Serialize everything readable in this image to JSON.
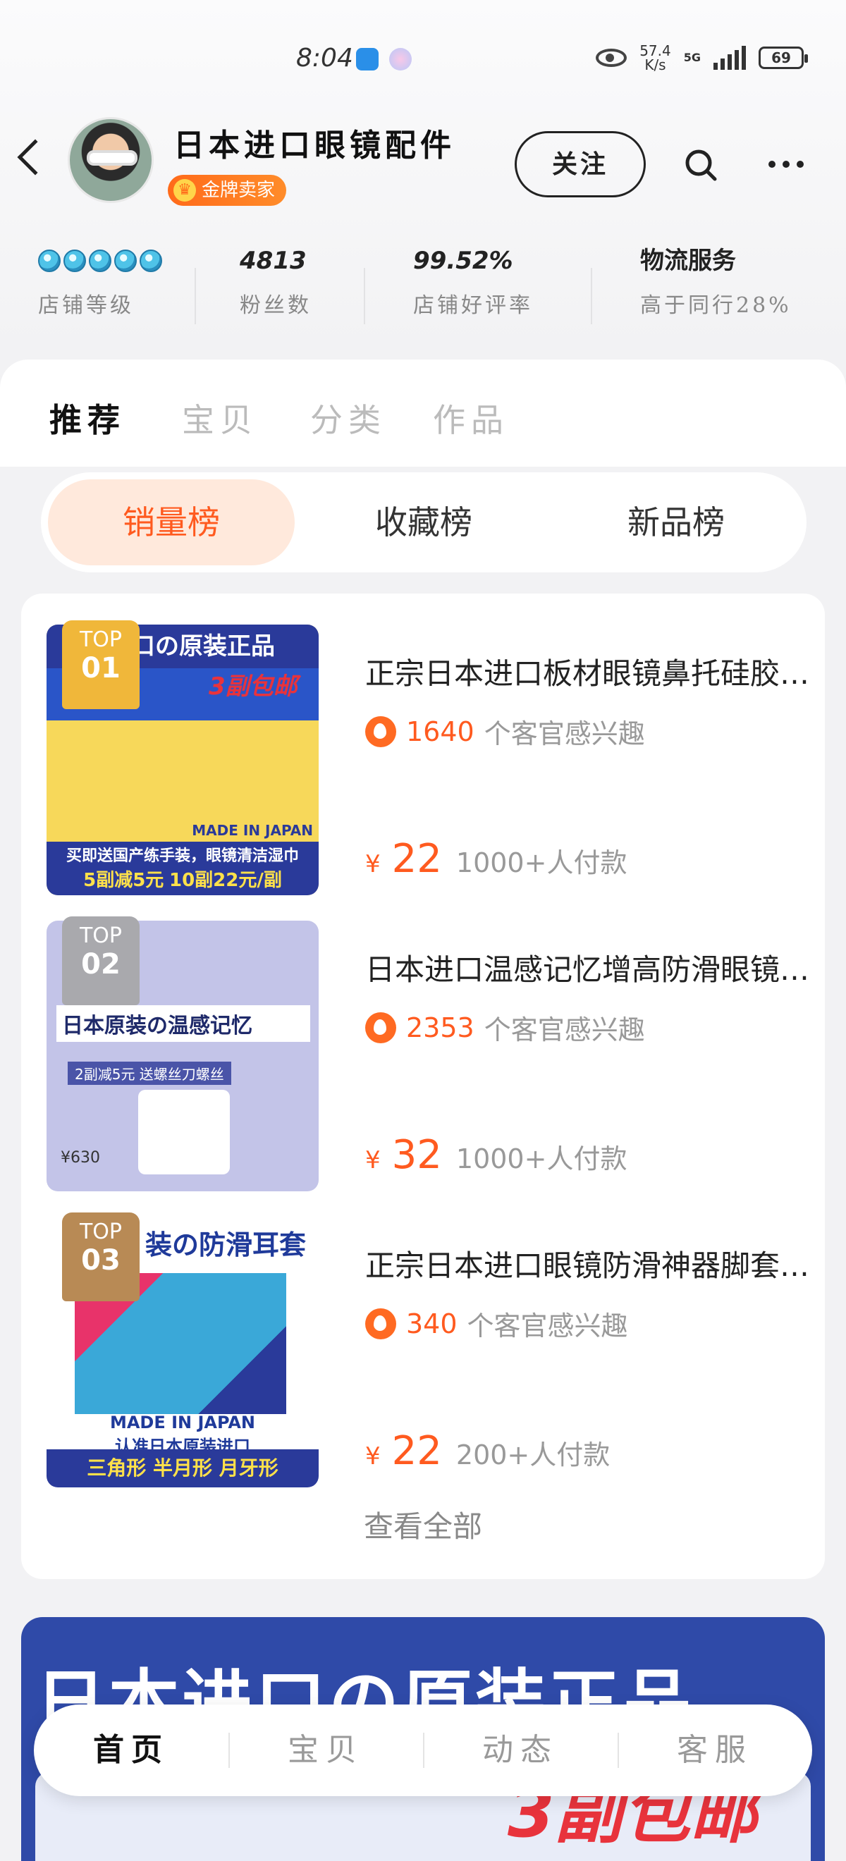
{
  "status_bar": {
    "time": "8:04",
    "net_speed_value": "57.4",
    "net_speed_unit": "K/s",
    "network": "5G",
    "battery": "69"
  },
  "shop": {
    "name": "日本进口眼镜配件",
    "badge": "金牌卖家",
    "follow_label": "关注"
  },
  "stats": {
    "level_label": "店铺等级",
    "level_gems": 5,
    "fans_value": "4813",
    "fans_label": "粉丝数",
    "rating_value": "99.52%",
    "rating_label": "店铺好评率",
    "logistics_value": "物流服务",
    "logistics_label": "高于同行28%"
  },
  "tabs": [
    "推荐",
    "宝贝",
    "分类",
    "作品"
  ],
  "rank_tabs": [
    "销量榜",
    "收藏榜",
    "新品榜"
  ],
  "items": [
    {
      "top_label": "TOP",
      "rank": "01",
      "title": "正宗日本进口板材眼镜鼻托硅胶防滑鼻垫",
      "interest_count": "1640",
      "interest_text": "个客官感兴趣",
      "currency": "¥",
      "price": "22",
      "sales": "1000+人付款",
      "thumb": {
        "top_text": "口の原装正品",
        "red_text": "3副包邮",
        "made_in": "MADE IN JAPAN",
        "line1": "买即送国产练手装，眼镜清洁湿巾",
        "line2a": "5副减5元",
        "line2b": "10副22元/副"
      }
    },
    {
      "top_label": "TOP",
      "rank": "02",
      "title": "日本进口温感记忆增高防滑眼镜鼻托",
      "interest_count": "2353",
      "interest_text": "个客官感兴趣",
      "currency": "¥",
      "price": "32",
      "sales": "1000+人付款",
      "thumb": {
        "main_text": "日本原装の温感记忆",
        "promo": "2副减5元 送螺丝刀螺丝",
        "price_text": "¥630"
      }
    },
    {
      "top_label": "TOP",
      "rank": "03",
      "title": "正宗日本进口眼镜防滑神器脚套耳勾",
      "interest_count": "340",
      "interest_text": "个客官感兴趣",
      "currency": "¥",
      "price": "22",
      "sales": "200+人付款",
      "thumb": {
        "top_text": "装の防滑耳套",
        "made_in": "MADE IN JAPAN",
        "subtitle": "认准日本原装进口",
        "bottom": "三角形 半月形 月牙形"
      }
    }
  ],
  "view_all": "查看全部",
  "banner": {
    "title": "日本进口の原装正品",
    "red_text": "3副包邮"
  },
  "bottom_nav": [
    "首页",
    "宝贝",
    "动态",
    "客服"
  ]
}
